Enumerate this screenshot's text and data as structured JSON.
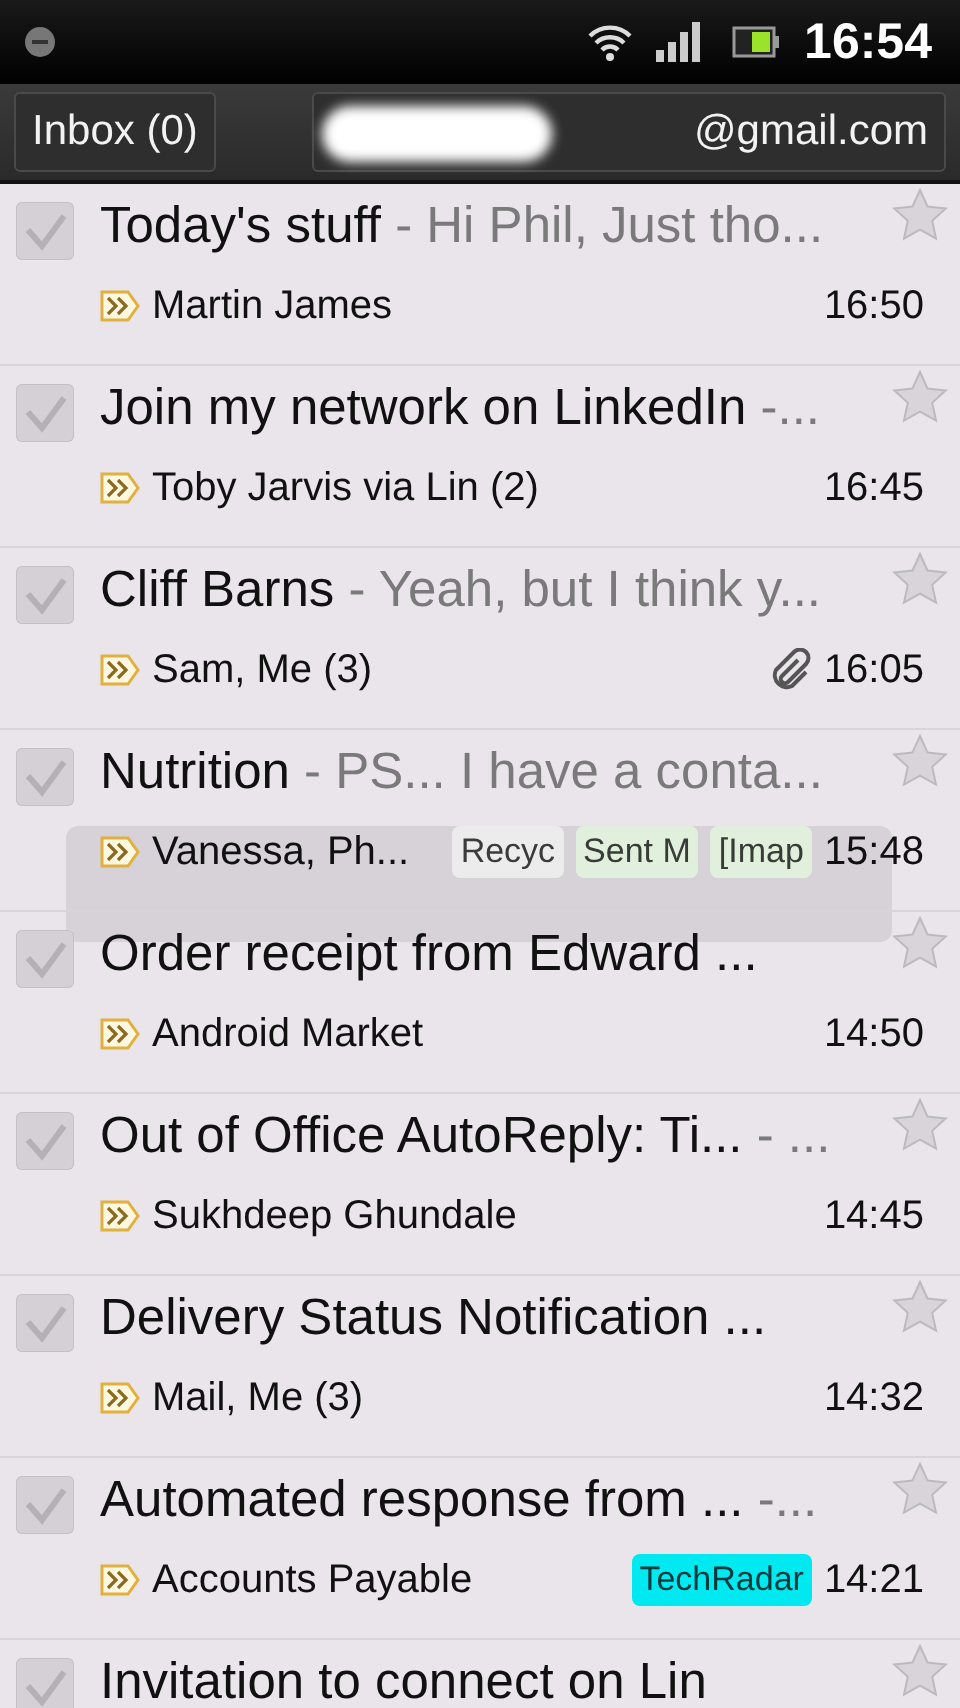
{
  "status_bar": {
    "time": "16:54"
  },
  "action_bar": {
    "mailbox": "Inbox (0)",
    "account": "@gmail.com"
  },
  "emails": [
    {
      "subject": "Today's stuff",
      "snippet": "- Hi Phil, Just tho...",
      "sender": "Martin James",
      "time": "16:50",
      "checked": false,
      "starred": false,
      "attachment": false
    },
    {
      "subject": "Join my network on LinkedIn",
      "snippet": "-...",
      "sender": "Toby Jarvis via Lin (2)",
      "time": "16:45",
      "checked": false,
      "starred": false,
      "attachment": false
    },
    {
      "subject": "Cliff Barns",
      "snippet": "- Yeah, but I think y...",
      "sender": "Sam, Me (3)",
      "time": "16:05",
      "checked": false,
      "starred": false,
      "attachment": true
    },
    {
      "subject": "Nutrition",
      "snippet": "- PS... I have a conta...",
      "sender": "Vanessa, Ph...",
      "time": "15:48",
      "checked": false,
      "starred": false,
      "attachment": false,
      "labels": [
        {
          "text": "Recyc",
          "color": "#ececec"
        },
        {
          "text": "Sent M",
          "color": "#e0f0dc"
        },
        {
          "text": "[Imap",
          "color": "#e0f0dc"
        }
      ]
    },
    {
      "subject": "Order receipt from Edward ...",
      "sender": "Android Market",
      "time": "14:50",
      "checked": false,
      "starred": false,
      "attachment": false
    },
    {
      "subject": "Out of Office AutoReply: Ti...",
      "snippet": "- ...",
      "sender": "Sukhdeep Ghundale",
      "time": "14:45",
      "checked": false,
      "starred": false,
      "attachment": false
    },
    {
      "subject": "Delivery Status Notification ...",
      "sender": "Mail, Me (3)",
      "time": "14:32",
      "checked": false,
      "starred": false,
      "attachment": false
    },
    {
      "subject": "Automated response from ...",
      "snippet": "-...",
      "sender": "Accounts Payable",
      "time": "14:21",
      "checked": false,
      "starred": false,
      "attachment": false,
      "labels": [
        {
          "text": "TechRadar",
          "color": "#00e8f0"
        }
      ]
    },
    {
      "subject": "Invitation to connect on Lin",
      "checked": false,
      "starred": false
    }
  ],
  "toast": {
    "visible": true
  }
}
